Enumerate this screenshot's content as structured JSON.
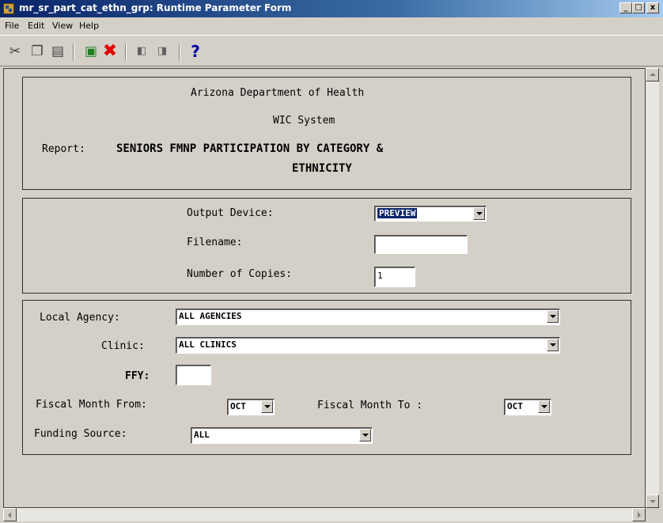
{
  "window": {
    "title": "mr_sr_part_cat_ethn_grp: Runtime Parameter Form",
    "minimize": "_",
    "maximize": "□",
    "close": "x"
  },
  "menu": [
    "File",
    "Edit",
    "View",
    "Help"
  ],
  "toolbar": {
    "icons": [
      "cut-icon",
      "copy-icon",
      "paste-icon",
      "run-icon",
      "cancel-icon",
      "previous-icon",
      "next-icon",
      "help-icon"
    ],
    "help_glyph": "?"
  },
  "header": {
    "org": "Arizona Department of Health",
    "system": "WIC System",
    "report_label": "Report:",
    "report_title_line1": "SENIORS FMNP PARTICIPATION BY CATEGORY &",
    "report_title_line2": "ETHNICITY"
  },
  "output": {
    "device_label": "Output Device:",
    "device_value": "PREVIEW",
    "filename_label": "Filename:",
    "filename_value": "",
    "copies_label": "Number of Copies:",
    "copies_value": "1"
  },
  "params": {
    "agency_label": "Local Agency:",
    "agency_value": "ALL AGENCIES",
    "clinic_label": "Clinic:",
    "clinic_value": "ALL CLINICS",
    "ffy_label": "FFY:",
    "ffy_value": "",
    "month_from_label": "Fiscal Month From:",
    "month_from_value": "OCT",
    "month_to_label": "Fiscal Month To :",
    "month_to_value": "OCT",
    "funding_label": "Funding Source:",
    "funding_value": "ALL"
  },
  "colors": {
    "titlebar": "#0a246a",
    "face": "#d4d0c8",
    "cancel_icon": "#e00000",
    "help_icon": "#0000a0"
  }
}
